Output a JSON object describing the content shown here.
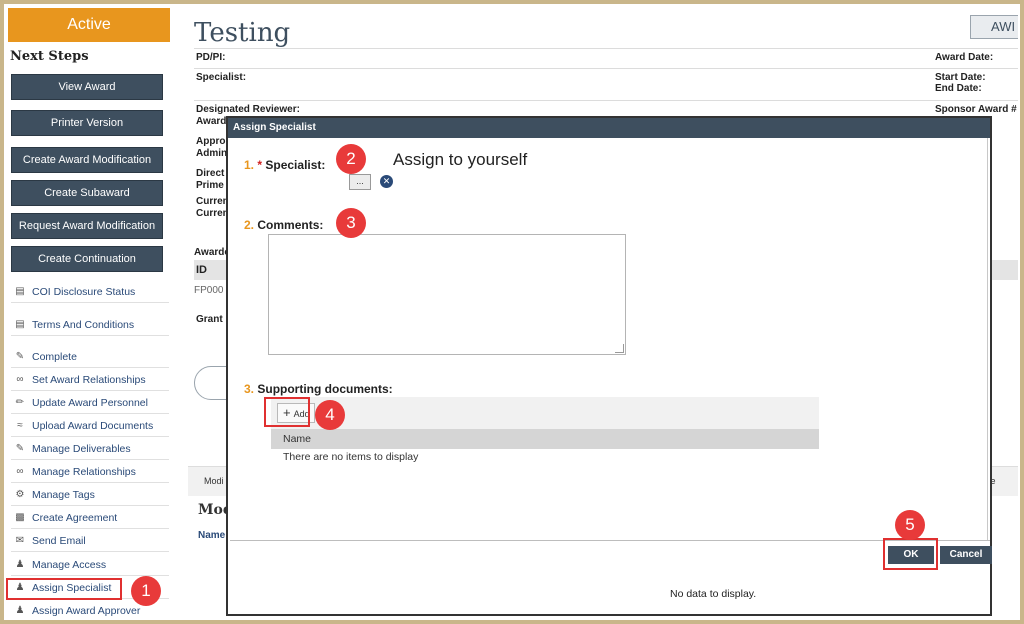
{
  "sidebar": {
    "state": "Active",
    "next_steps_heading": "Next Steps",
    "buttons": [
      "View Award",
      "Printer Version",
      "Create Award Modification",
      "Create Subaward",
      "Request Award Modification",
      "Create Continuation"
    ],
    "actions": [
      {
        "label": "COI Disclosure Status",
        "icon": "list-icon"
      },
      {
        "label": "Terms And Conditions",
        "icon": "list-icon"
      },
      {
        "label": "Complete",
        "icon": "edit-icon"
      },
      {
        "label": "Set Award Relationships",
        "icon": "link-icon"
      },
      {
        "label": "Update Award Personnel",
        "icon": "pencil-icon"
      },
      {
        "label": "Upload Award Documents",
        "icon": "paperclip-icon"
      },
      {
        "label": "Manage Deliverables",
        "icon": "edit-icon"
      },
      {
        "label": "Manage Relationships",
        "icon": "link-icon"
      },
      {
        "label": "Manage Tags",
        "icon": "gear-icon"
      },
      {
        "label": "Create Agreement",
        "icon": "document-icon"
      },
      {
        "label": "Send Email",
        "icon": "envelope-icon"
      },
      {
        "label": "Manage Access",
        "icon": "users-icon"
      },
      {
        "label": "Assign Specialist",
        "icon": "user-plus-icon"
      },
      {
        "label": "Assign Award Approver",
        "icon": "user-plus-icon"
      }
    ]
  },
  "page": {
    "title": "Testing",
    "top_button": "AWI",
    "fields_left": [
      "PD/PI:",
      "Specialist:",
      "Designated Reviewer:",
      "Award",
      "Appro",
      "Admin",
      "Direct",
      "Prime",
      "Curren",
      "Curren",
      "Awarde",
      "ID",
      "FP000",
      "Grant"
    ],
    "fields_right": [
      "Award Date:",
      "Start Date:",
      "End Date:",
      "Sponsor Award #"
    ],
    "tab_fragments": [
      "Modi",
      "ce"
    ],
    "section_heading": "Modi",
    "column_fragment": "Name"
  },
  "modal": {
    "title": "Assign Specialist",
    "q1": {
      "num": "1.",
      "required": "*",
      "label": "Specialist:",
      "hint": "Assign to yourself",
      "picker": "..."
    },
    "q2": {
      "num": "2.",
      "label": "Comments:",
      "value": ""
    },
    "q3": {
      "num": "3.",
      "label": "Supporting documents:",
      "add_label": "Add",
      "column": "Name",
      "empty": "There are no items to display"
    },
    "ok": "OK",
    "cancel": "Cancel",
    "no_data": "No data to display."
  },
  "markers": [
    "1",
    "2",
    "3",
    "4",
    "5"
  ],
  "colors": {
    "accent_orange": "#e8961e",
    "nav_dark": "#3e4f5f",
    "highlight_red": "#e03030",
    "frame": "#c9b68a"
  }
}
